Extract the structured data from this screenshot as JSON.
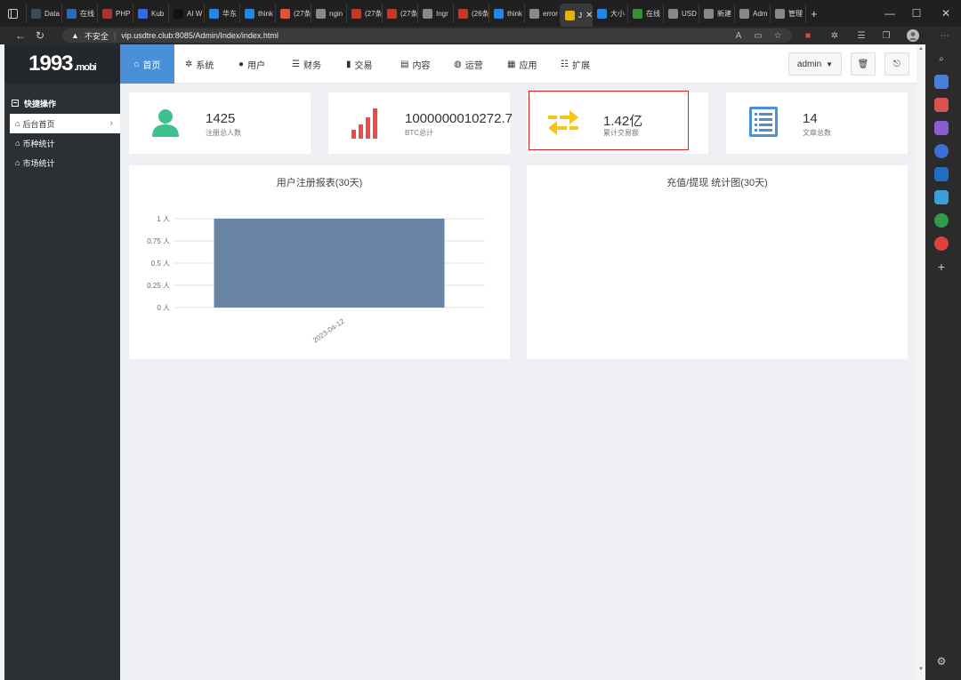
{
  "browser": {
    "tabs": [
      {
        "label": "Data",
        "color": "#3b4a5a"
      },
      {
        "label": "在线",
        "color": "#2b6cb0"
      },
      {
        "label": "PHP",
        "color": "#a33"
      },
      {
        "label": "Kub",
        "color": "#326ce5"
      },
      {
        "label": "AI W",
        "color": "#111"
      },
      {
        "label": "华东",
        "color": "#1e88e5"
      },
      {
        "label": "think",
        "color": "#1e88e5"
      },
      {
        "label": "(27条",
        "color": "#e0533a"
      },
      {
        "label": "ngin",
        "color": "#888"
      },
      {
        "label": "(27条",
        "color": "#c0392b"
      },
      {
        "label": "(27条",
        "color": "#c0392b"
      },
      {
        "label": "Ingr",
        "color": "#888"
      },
      {
        "label": "(26条",
        "color": "#c0392b"
      },
      {
        "label": "think",
        "color": "#1e88e5"
      },
      {
        "label": "error",
        "color": "#888"
      },
      {
        "label": "J",
        "color": "#e6b400"
      },
      {
        "label": "大小",
        "color": "#1e88e5"
      },
      {
        "label": "在线",
        "color": "#3a8e3a"
      },
      {
        "label": "USD",
        "color": "#888"
      },
      {
        "label": "新建",
        "color": "#888"
      },
      {
        "label": "Adm",
        "color": "#888"
      },
      {
        "label": "管理",
        "color": "#888"
      }
    ],
    "active_tab_close": "✕",
    "new_tab": "+",
    "minimize": "—",
    "maximize": "☐",
    "close": "✕",
    "security_label": "不安全",
    "url": "vip.usdtre.club:8085/Admin/Index/index.html"
  },
  "sidebar": {
    "logo": "1993",
    "logo_suffix": ".mobi",
    "section_title": "快捷操作",
    "items": [
      {
        "label": "后台首页"
      },
      {
        "label": "币种统计"
      },
      {
        "label": "市场统计"
      }
    ]
  },
  "topnav": {
    "items": [
      {
        "label": "首页",
        "icon": "home-icon"
      },
      {
        "label": "系统",
        "icon": "gear-icon"
      },
      {
        "label": "用户",
        "icon": "user-icon"
      },
      {
        "label": "财务",
        "icon": "list-icon"
      },
      {
        "label": "交易",
        "icon": "bar-chart-icon"
      },
      {
        "label": "内容",
        "icon": "document-icon"
      },
      {
        "label": "运营",
        "icon": "globe-icon"
      },
      {
        "label": "应用",
        "icon": "grid-icon"
      },
      {
        "label": "扩展",
        "icon": "tasks-icon"
      }
    ],
    "admin_label": "admin"
  },
  "stats": [
    {
      "value": "1425",
      "label": "注册总人数",
      "color": "#3cc08c"
    },
    {
      "value": "1000000010272.7",
      "label": "BTC总计",
      "color": "#e94b4b"
    },
    {
      "value": "1.42亿",
      "label": "累计交易额",
      "color": "#f5c518"
    },
    {
      "value": "14",
      "label": "文章总数",
      "color": "#4a90d9"
    }
  ],
  "panels": {
    "register_title": "用户注册报表(30天)",
    "recharge_title": "充值/提现 统计图(30天)"
  },
  "chart_data": {
    "type": "bar",
    "title": "用户注册报表(30天)",
    "categories": [
      "2023-04-12"
    ],
    "values": [
      1
    ],
    "ylim": [
      0,
      1
    ],
    "yticks": [
      "0 人",
      "0.25 人",
      "0.5 人",
      "0.75 人",
      "1 人"
    ],
    "ytick_values": [
      0,
      0.25,
      0.5,
      0.75,
      1
    ],
    "bar_color": "#6a84a6",
    "grid": true
  }
}
